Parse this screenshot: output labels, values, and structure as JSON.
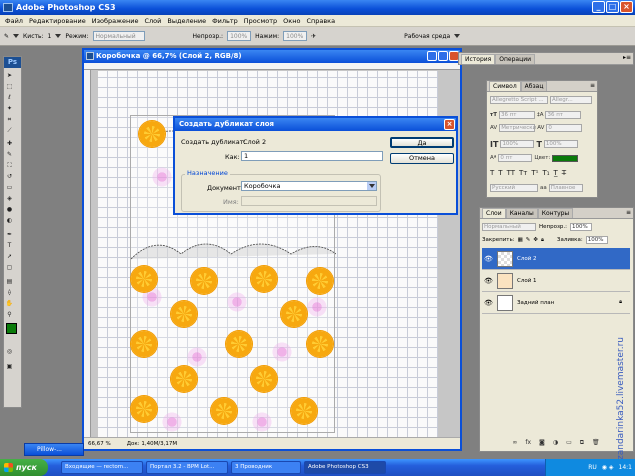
{
  "app": {
    "title": "Adobe Photoshop CS3"
  },
  "menu": [
    "Файл",
    "Редактирование",
    "Изображение",
    "Слой",
    "Выделение",
    "Фильтр",
    "Просмотр",
    "Окно",
    "Справка"
  ],
  "options_bar": {
    "brushes_label": "Кисть:",
    "brush_size": "1",
    "mode_label": "Режим:",
    "mode_value": "Нормальный",
    "opacity_label": "Непрозр.:",
    "opacity_value": "100%",
    "pressure_label": "Нажим:",
    "pressure_value": "100%",
    "workspace": "Рабочая среда"
  },
  "document": {
    "title": "Коробочка @ 66,7% (Слой 2, RGB/8)",
    "zoom": "66,67 %",
    "doc_size": "Док: 1,40M/3,17M"
  },
  "dialog": {
    "title": "Создать дубликат слоя",
    "duplicate_label": "Создать дубликат:",
    "duplicate_value": "Слой 2",
    "as_label": "Как:",
    "as_value": "1",
    "ok": "Да",
    "cancel": "Отмена",
    "group_label": "Назначение",
    "document_label": "Документ:",
    "document_value": "Коробочка",
    "name_label": "Имя:",
    "name_value": ""
  },
  "history_panel": {
    "tabs": [
      "История",
      "Операции"
    ]
  },
  "character_panel": {
    "tabs": [
      "Символ",
      "Абзац"
    ],
    "font": "Allegretto Script ...",
    "style": "Allegr...",
    "size": "36 пт",
    "leading": "36 пт",
    "kerning": "Метрически",
    "tracking": "0",
    "vscale": "100%",
    "hscale": "100%",
    "baseline": "0 пт",
    "color_label": "Цвет:",
    "color": "#0a7a0a",
    "language": "Русский",
    "aa": "Плавное"
  },
  "layers_panel": {
    "tabs": [
      "Слои",
      "Каналы",
      "Контуры"
    ],
    "blend": "Нормальный",
    "opacity_label": "Непрозр.:",
    "opacity": "100%",
    "lock_label": "Закрепить:",
    "fill_label": "Заливка:",
    "fill": "100%",
    "layers": [
      {
        "name": "Слой 2",
        "selected": true
      },
      {
        "name": "Слой 1",
        "selected": false
      },
      {
        "name": "Задний план",
        "selected": false
      }
    ]
  },
  "minimized_doc": {
    "title": "Pillow-..."
  },
  "taskbar": {
    "start": "пуск",
    "items": [
      "Входящие — rectom...",
      "Портал 3.2 - ВРМ Lot...",
      "3 Проводник",
      "Adobe Photoshop CS3"
    ],
    "lang": "RU",
    "time": "14:1"
  },
  "watermark": "zandarinka52.livemaster.ru"
}
